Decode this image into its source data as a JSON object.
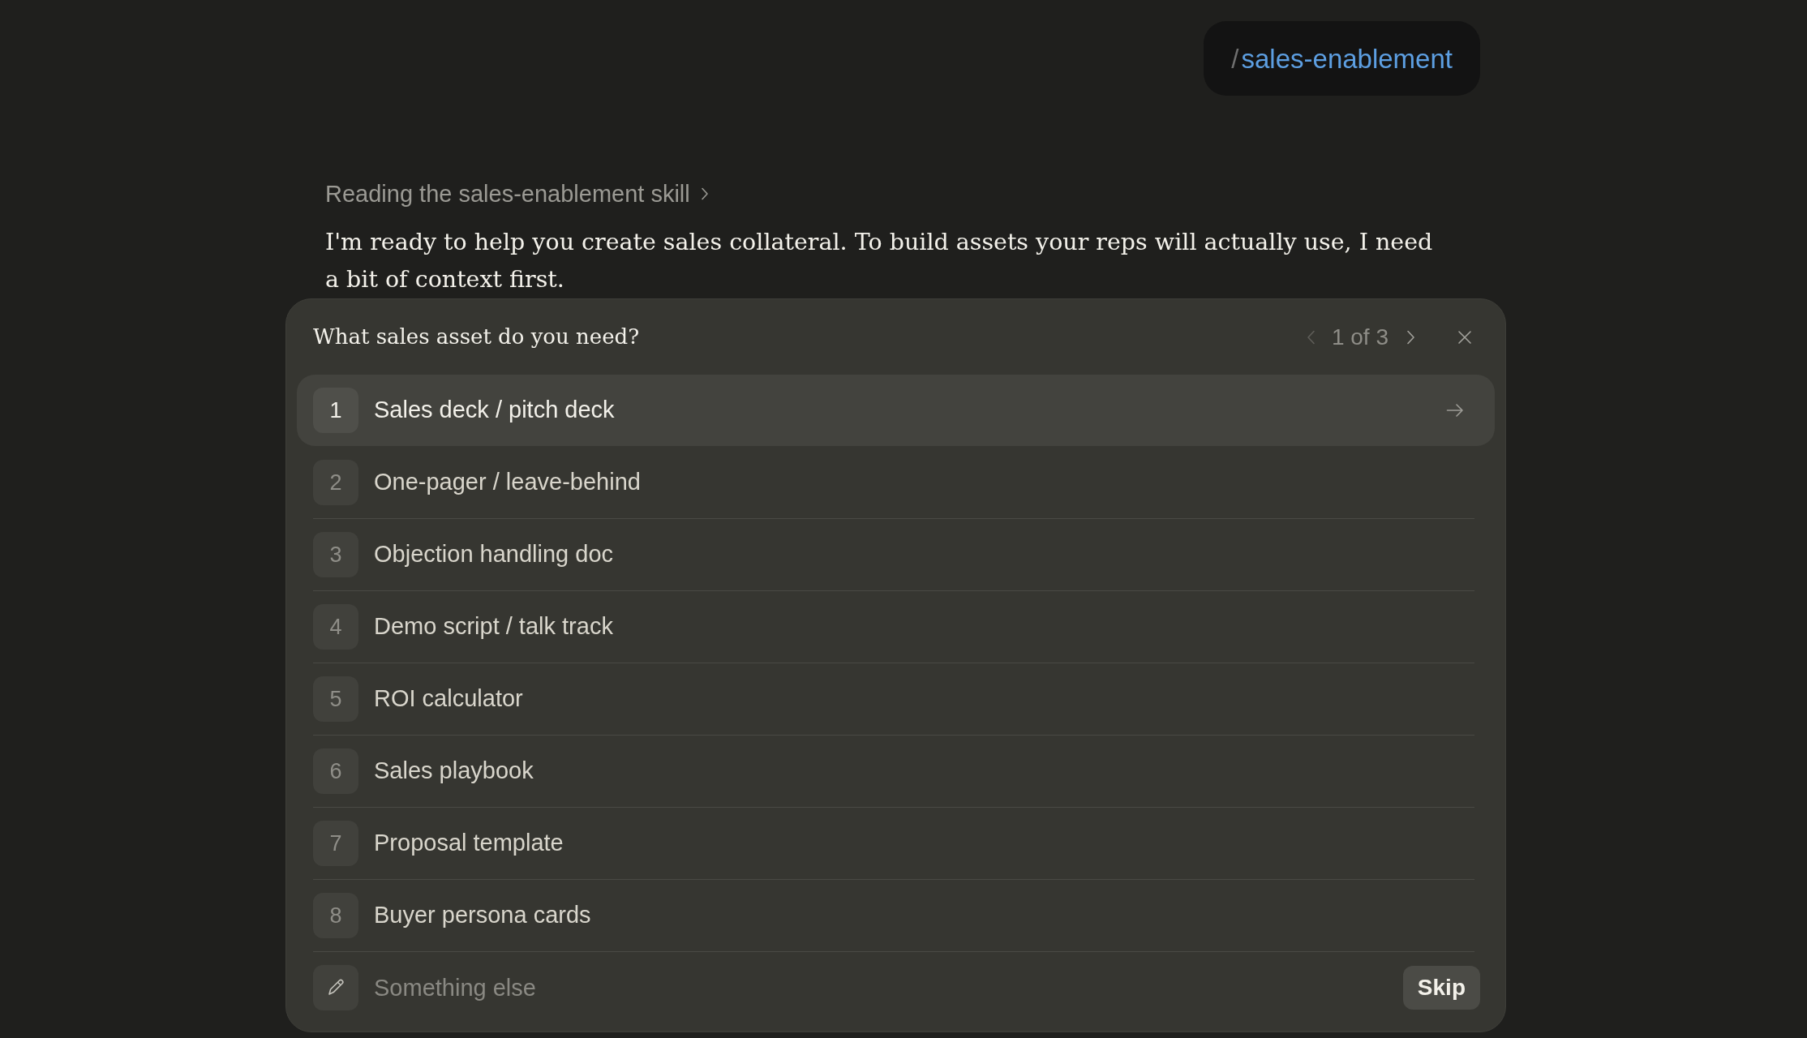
{
  "user_message": {
    "prefix": "/",
    "command": "sales-enablement"
  },
  "status": {
    "text": "Reading the sales-enablement skill",
    "expanded": false
  },
  "assistant_message": "I'm ready to help you create sales collateral. To build assets your reps will actually use, I need a bit of context first.",
  "question_panel": {
    "question": "What sales asset do you need?",
    "pager": {
      "text": "1 of 3",
      "prev_disabled": true,
      "next_disabled": false
    },
    "options": [
      {
        "number": "1",
        "label": "Sales deck / pitch deck",
        "selected": true
      },
      {
        "number": "2",
        "label": "One-pager / leave-behind",
        "selected": false
      },
      {
        "number": "3",
        "label": "Objection handling doc",
        "selected": false
      },
      {
        "number": "4",
        "label": "Demo script / talk track",
        "selected": false
      },
      {
        "number": "5",
        "label": "ROI calculator",
        "selected": false
      },
      {
        "number": "6",
        "label": "Sales playbook",
        "selected": false
      },
      {
        "number": "7",
        "label": "Proposal template",
        "selected": false
      },
      {
        "number": "8",
        "label": "Buyer persona cards",
        "selected": false
      }
    ],
    "custom_answer": {
      "placeholder": "Something else"
    },
    "skip_button": "Skip"
  }
}
